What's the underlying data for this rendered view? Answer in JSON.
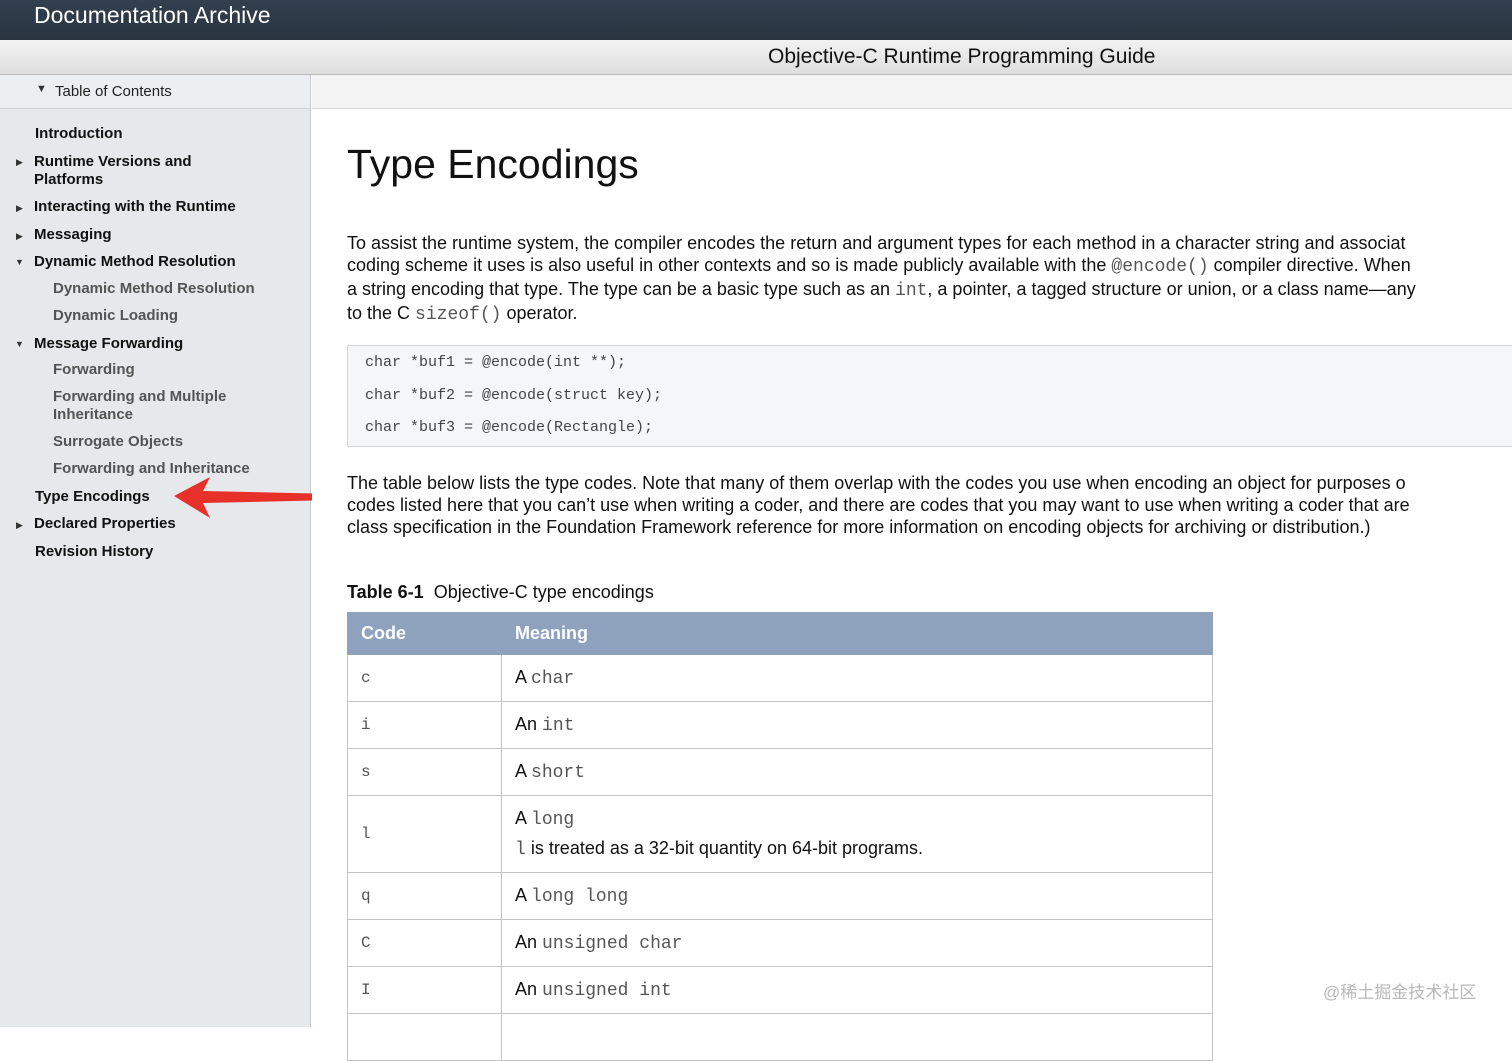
{
  "topbar": {
    "title": "Documentation Archive"
  },
  "guide": {
    "title": "Objective-C Runtime Programming Guide"
  },
  "sidebar": {
    "toc_label": "Table of Contents",
    "items": [
      {
        "label": "Introduction"
      },
      {
        "label": "Runtime Versions and",
        "label2": "Platforms"
      },
      {
        "label": "Interacting with the Runtime"
      },
      {
        "label": "Messaging"
      },
      {
        "label": "Dynamic Method Resolution"
      },
      {
        "label": "Dynamic Method Resolution"
      },
      {
        "label": "Dynamic Loading"
      },
      {
        "label": "Message Forwarding"
      },
      {
        "label": "Forwarding"
      },
      {
        "label": "Forwarding and Multiple",
        "label2": "Inheritance"
      },
      {
        "label": "Surrogate Objects"
      },
      {
        "label": "Forwarding and Inheritance"
      },
      {
        "label": "Type Encodings"
      },
      {
        "label": "Declared Properties"
      },
      {
        "label": "Revision History"
      }
    ]
  },
  "main": {
    "title": "Type Encodings",
    "intro": {
      "l1": "To assist the runtime system, the compiler encodes the return and argument types for each method in a character string and associat",
      "l2a": "coding scheme it uses is also useful in other contexts and so is made publicly available with the ",
      "l2code": "@encode()",
      "l2b": " compiler directive. When",
      "l3a": "a string encoding that type. The type can be a basic type such as an ",
      "l3code": "int",
      "l3b": ", a pointer, a tagged structure or union, or a class name—any",
      "l4a": "to the C ",
      "l4code": "sizeof()",
      "l4b": " operator."
    },
    "code_lines": [
      "char *buf1 = @encode(int **);",
      "char *buf2 = @encode(struct key);",
      "char *buf3 = @encode(Rectangle);"
    ],
    "para2": {
      "l1": "The table below lists the type codes. Note that many of them overlap with the codes you use when encoding an object for purposes o",
      "l2": "codes listed here that you can’t use when writing a coder, and there are codes that you may want to use when writing a coder that are",
      "l3": "class specification in the Foundation Framework reference for more information on encoding objects for archiving or distribution.)"
    },
    "table": {
      "caption_num": "Table 6-1",
      "caption_text": "Objective-C type encodings",
      "headers": [
        "Code",
        "Meaning"
      ],
      "rows": [
        {
          "code": "c",
          "art": "A",
          "type": "char"
        },
        {
          "code": "i",
          "art": "An",
          "type": "int"
        },
        {
          "code": "s",
          "art": "A",
          "type": "short"
        },
        {
          "code": "l",
          "art": "A",
          "type": "long",
          "note_code": "l",
          "note": " is treated as a 32-bit quantity on 64-bit programs."
        },
        {
          "code": "q",
          "art": "A",
          "type": "long long"
        },
        {
          "code": "C",
          "art": "An",
          "type": "unsigned char"
        },
        {
          "code": "I",
          "art": "An",
          "type": "unsigned int"
        }
      ]
    }
  },
  "watermark": "@稀土掘金技术社区",
  "colors": {
    "accent_arrow": "#e8302a",
    "table_header": "#8ea1bd",
    "topbar": "#2f3a48"
  }
}
